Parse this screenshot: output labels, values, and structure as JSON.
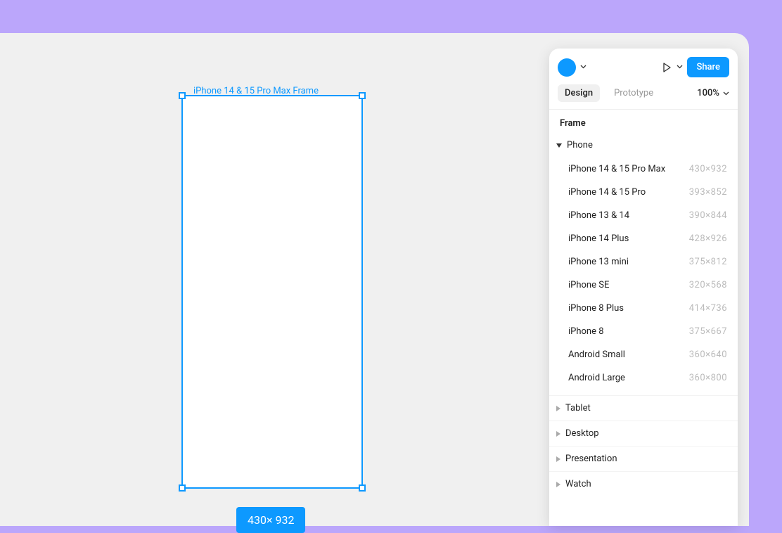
{
  "colors": {
    "accent": "#0d99ff",
    "page_bg": "#bba6fb",
    "canvas_bg": "#f0f0f0"
  },
  "canvas": {
    "frame_label": "iPhone 14 & 15 Pro Max Frame",
    "dimension_badge": "430× 932"
  },
  "panel": {
    "share_label": "Share",
    "tabs": {
      "design": "Design",
      "prototype": "Prototype"
    },
    "zoom": "100%",
    "section_title": "Frame",
    "categories": [
      {
        "name": "Phone",
        "expanded": true,
        "presets": [
          {
            "name": "iPhone 14 & 15 Pro Max",
            "dim": "430×932"
          },
          {
            "name": "iPhone 14 & 15 Pro",
            "dim": "393×852"
          },
          {
            "name": "iPhone 13 & 14",
            "dim": "390×844"
          },
          {
            "name": "iPhone 14 Plus",
            "dim": "428×926"
          },
          {
            "name": "iPhone 13 mini",
            "dim": "375×812"
          },
          {
            "name": "iPhone SE",
            "dim": "320×568"
          },
          {
            "name": "iPhone 8 Plus",
            "dim": "414×736"
          },
          {
            "name": "iPhone 8",
            "dim": "375×667"
          },
          {
            "name": "Android Small",
            "dim": "360×640"
          },
          {
            "name": "Android Large",
            "dim": "360×800"
          }
        ]
      },
      {
        "name": "Tablet",
        "expanded": false
      },
      {
        "name": "Desktop",
        "expanded": false
      },
      {
        "name": "Presentation",
        "expanded": false
      },
      {
        "name": "Watch",
        "expanded": false
      }
    ]
  }
}
